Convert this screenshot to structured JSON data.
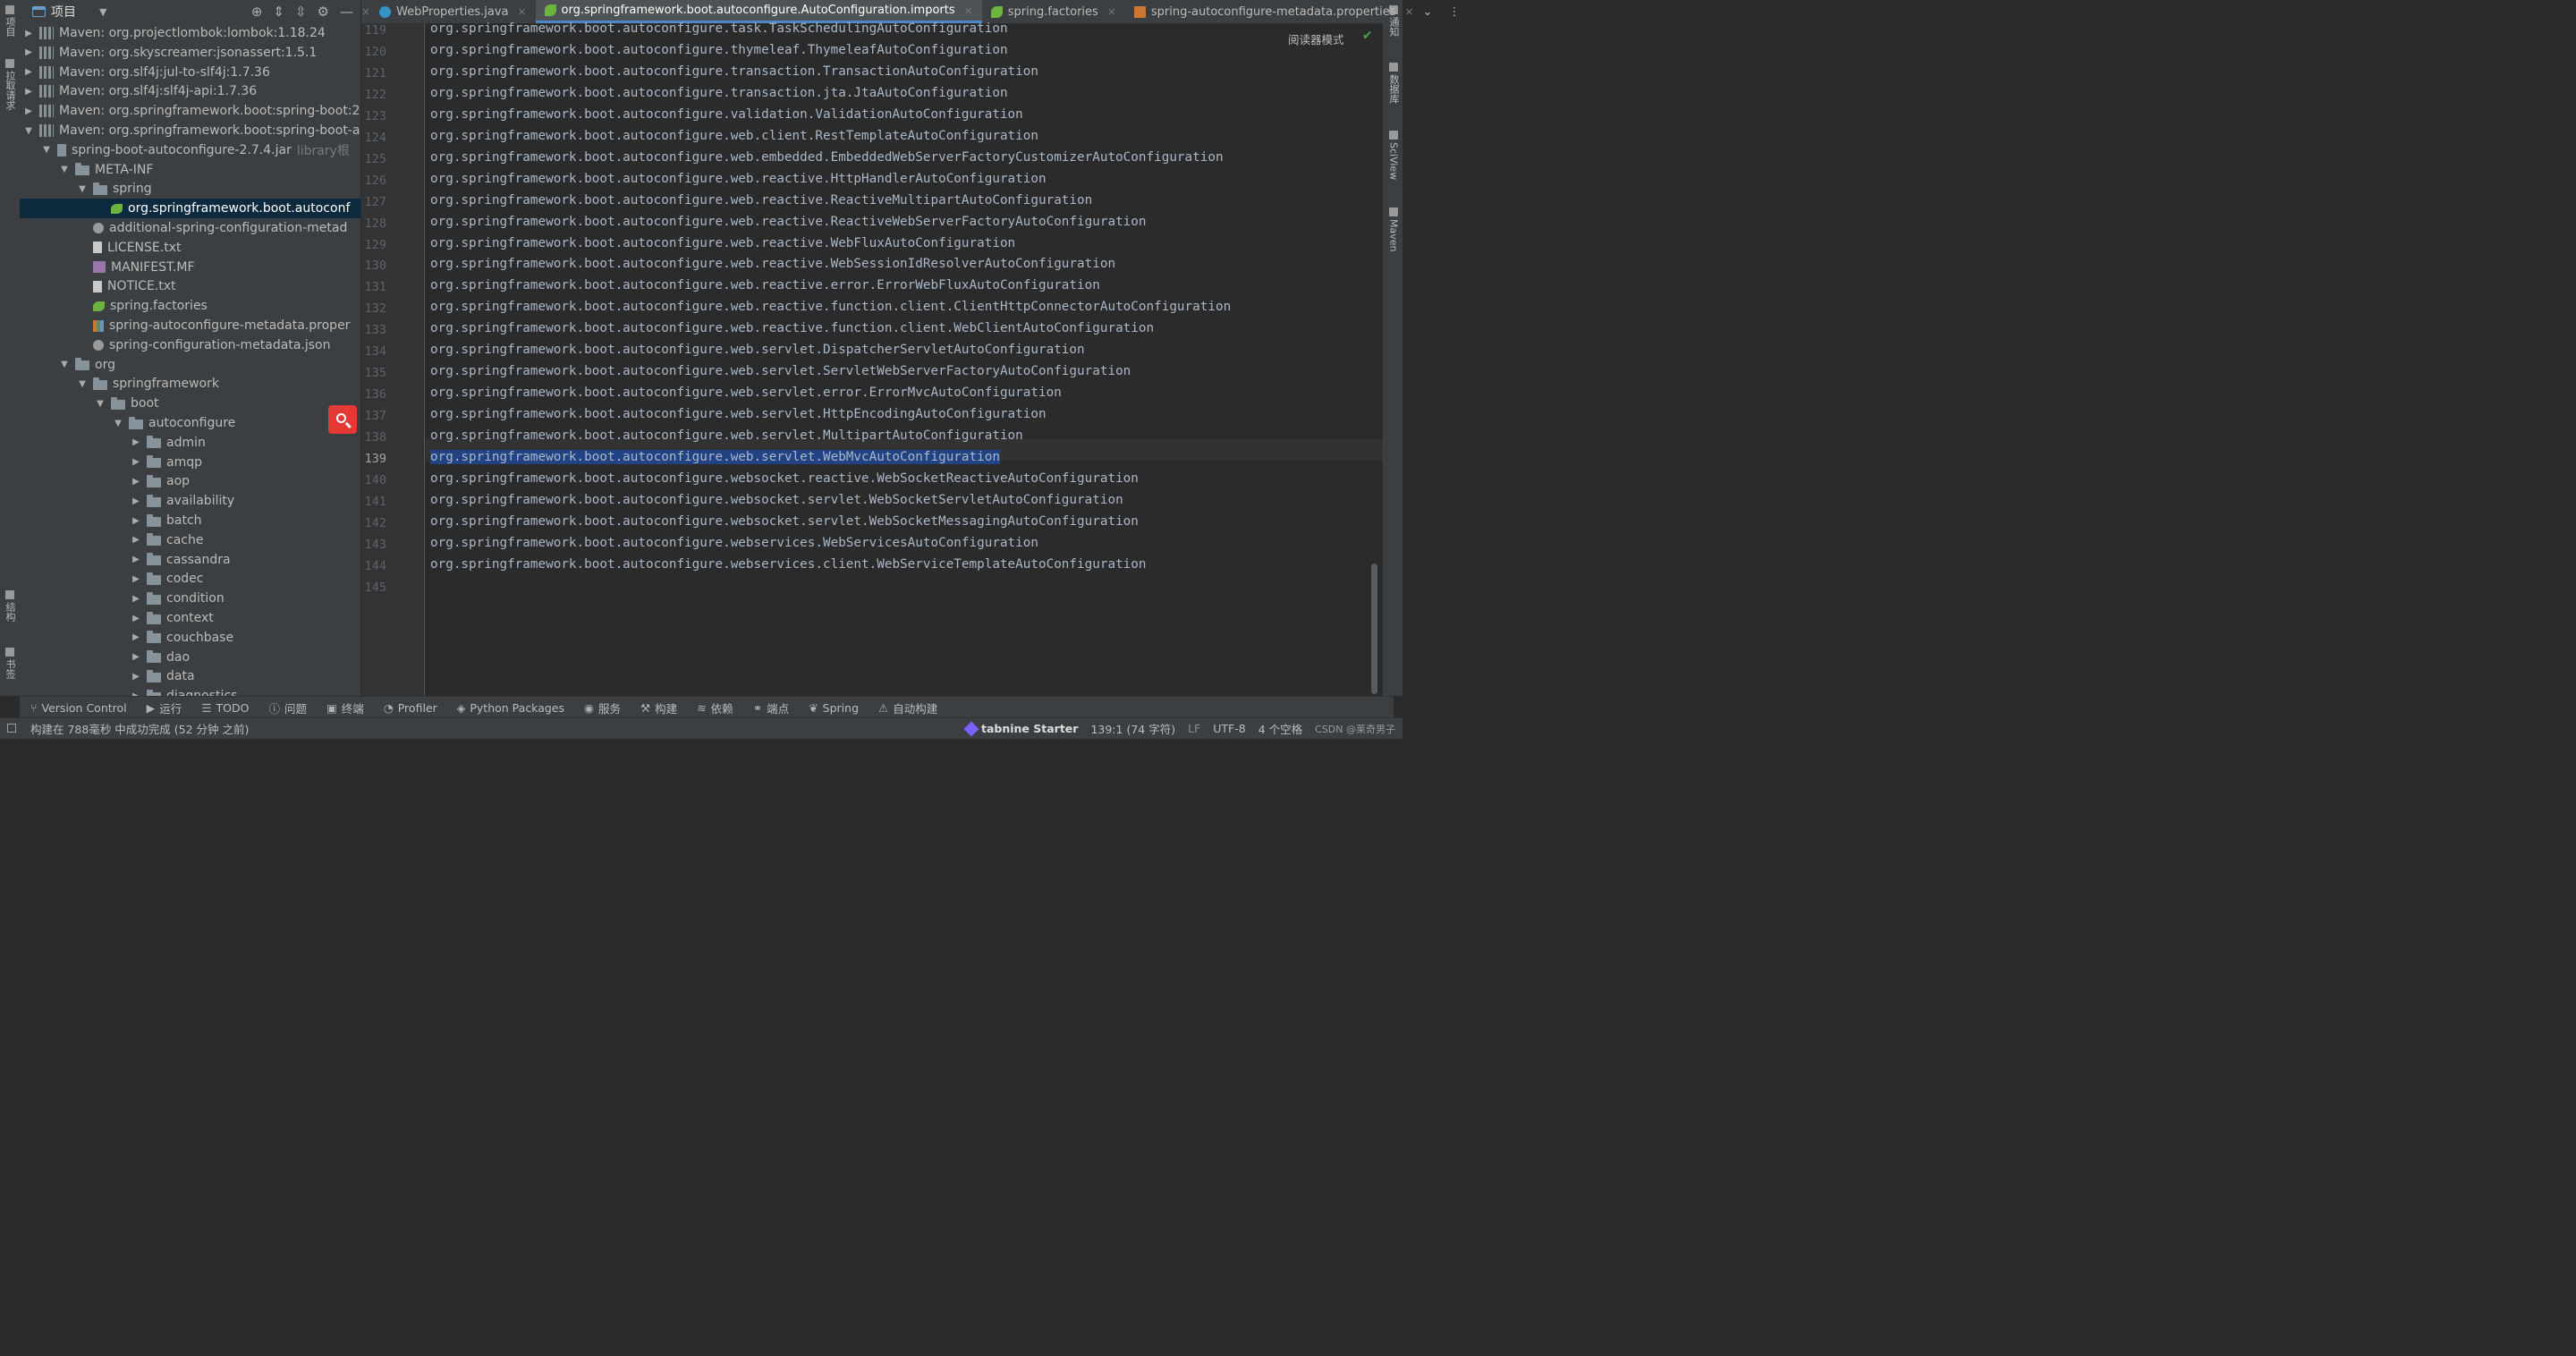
{
  "left_stripe": {
    "top_tabs": [
      "项目",
      "拉取请求"
    ],
    "bottom_tabs": [
      "结构",
      "书签"
    ]
  },
  "right_stripe": {
    "tabs": [
      "通知",
      "数据库",
      "SciView",
      "Maven"
    ]
  },
  "project_panel": {
    "title": "项目",
    "tree": [
      {
        "label": "Maven: org.projectlombok:lombok:1.18.24",
        "icon": "library-icon",
        "expanded": false
      },
      {
        "label": "Maven: org.skyscreamer:jsonassert:1.5.1",
        "icon": "library-icon",
        "expanded": false
      },
      {
        "label": "Maven: org.slf4j:jul-to-slf4j:1.7.36",
        "icon": "library-icon",
        "expanded": false
      },
      {
        "label": "Maven: org.slf4j:slf4j-api:1.7.36",
        "icon": "library-icon",
        "expanded": false
      },
      {
        "label": "Maven: org.springframework.boot:spring-boot:2",
        "icon": "library-icon",
        "expanded": false
      },
      {
        "label": "Maven: org.springframework.boot:spring-boot-a",
        "icon": "library-icon",
        "expanded": true
      },
      {
        "label": "spring-boot-autoconfigure-2.7.4.jar",
        "suffix": "library根",
        "icon": "jar-icon",
        "expanded": true
      },
      {
        "label": "META-INF",
        "icon": "folder-icon",
        "expanded": true
      },
      {
        "label": "spring",
        "icon": "folder-icon",
        "expanded": true
      },
      {
        "label": "org.springframework.boot.autoconf",
        "icon": "spring-icon",
        "selected": true
      },
      {
        "label": "additional-spring-configuration-metad",
        "icon": "json-icon"
      },
      {
        "label": "LICENSE.txt",
        "icon": "text-file-icon"
      },
      {
        "label": "MANIFEST.MF",
        "icon": "manifest-icon"
      },
      {
        "label": "NOTICE.txt",
        "icon": "text-file-icon"
      },
      {
        "label": "spring.factories",
        "icon": "spring-icon"
      },
      {
        "label": "spring-autoconfigure-metadata.proper",
        "icon": "properties-icon"
      },
      {
        "label": "spring-configuration-metadata.json",
        "icon": "json-icon"
      },
      {
        "label": "org",
        "icon": "folder-icon",
        "expanded": true
      },
      {
        "label": "springframework",
        "icon": "folder-icon",
        "expanded": true
      },
      {
        "label": "boot",
        "icon": "folder-icon",
        "expanded": true
      },
      {
        "label": "autoconfigure",
        "icon": "folder-icon",
        "expanded": true
      },
      {
        "label": "admin",
        "icon": "folder-icon",
        "expanded": false
      },
      {
        "label": "amqp",
        "icon": "folder-icon",
        "expanded": false
      },
      {
        "label": "aop",
        "icon": "folder-icon",
        "expanded": false
      },
      {
        "label": "availability",
        "icon": "folder-icon",
        "expanded": false
      },
      {
        "label": "batch",
        "icon": "folder-icon",
        "expanded": false
      },
      {
        "label": "cache",
        "icon": "folder-icon",
        "expanded": false
      },
      {
        "label": "cassandra",
        "icon": "folder-icon",
        "expanded": false
      },
      {
        "label": "codec",
        "icon": "folder-icon",
        "expanded": false
      },
      {
        "label": "condition",
        "icon": "folder-icon",
        "expanded": false
      },
      {
        "label": "context",
        "icon": "folder-icon",
        "expanded": false
      },
      {
        "label": "couchbase",
        "icon": "folder-icon",
        "expanded": false
      },
      {
        "label": "dao",
        "icon": "folder-icon",
        "expanded": false
      },
      {
        "label": "data",
        "icon": "folder-icon",
        "expanded": false
      },
      {
        "label": "diagnostics",
        "icon": "folder-icon",
        "expanded": false
      }
    ]
  },
  "editor": {
    "tabs": [
      {
        "label": "WebProperties.java",
        "icon": "java-class-icon",
        "active": false
      },
      {
        "label": "org.springframework.boot.autoconfigure.AutoConfiguration.imports",
        "icon": "spring-icon",
        "active": true
      },
      {
        "label": "spring.factories",
        "icon": "spring-icon",
        "active": false
      },
      {
        "label": "spring-autoconfigure-metadata.properties",
        "icon": "properties-icon",
        "active": false
      }
    ],
    "reader_mode": "阅读器模式",
    "current_line": "139",
    "lines": [
      {
        "num": "119",
        "text": "org.springframework.boot.autoconfigure.task.TaskSchedulingAutoConfiguration"
      },
      {
        "num": "120",
        "text": "org.springframework.boot.autoconfigure.thymeleaf.ThymeleafAutoConfiguration"
      },
      {
        "num": "121",
        "text": "org.springframework.boot.autoconfigure.transaction.TransactionAutoConfiguration"
      },
      {
        "num": "122",
        "text": "org.springframework.boot.autoconfigure.transaction.jta.JtaAutoConfiguration"
      },
      {
        "num": "123",
        "text": "org.springframework.boot.autoconfigure.validation.ValidationAutoConfiguration"
      },
      {
        "num": "124",
        "text": "org.springframework.boot.autoconfigure.web.client.RestTemplateAutoConfiguration"
      },
      {
        "num": "125",
        "text": "org.springframework.boot.autoconfigure.web.embedded.EmbeddedWebServerFactoryCustomizerAutoConfiguration"
      },
      {
        "num": "126",
        "text": "org.springframework.boot.autoconfigure.web.reactive.HttpHandlerAutoConfiguration"
      },
      {
        "num": "127",
        "text": "org.springframework.boot.autoconfigure.web.reactive.ReactiveMultipartAutoConfiguration"
      },
      {
        "num": "128",
        "text": "org.springframework.boot.autoconfigure.web.reactive.ReactiveWebServerFactoryAutoConfiguration"
      },
      {
        "num": "129",
        "text": "org.springframework.boot.autoconfigure.web.reactive.WebFluxAutoConfiguration"
      },
      {
        "num": "130",
        "text": "org.springframework.boot.autoconfigure.web.reactive.WebSessionIdResolverAutoConfiguration"
      },
      {
        "num": "131",
        "text": "org.springframework.boot.autoconfigure.web.reactive.error.ErrorWebFluxAutoConfiguration"
      },
      {
        "num": "132",
        "text": "org.springframework.boot.autoconfigure.web.reactive.function.client.ClientHttpConnectorAutoConfiguration"
      },
      {
        "num": "133",
        "text": "org.springframework.boot.autoconfigure.web.reactive.function.client.WebClientAutoConfiguration"
      },
      {
        "num": "134",
        "text": "org.springframework.boot.autoconfigure.web.servlet.DispatcherServletAutoConfiguration"
      },
      {
        "num": "135",
        "text": "org.springframework.boot.autoconfigure.web.servlet.ServletWebServerFactoryAutoConfiguration"
      },
      {
        "num": "136",
        "text": "org.springframework.boot.autoconfigure.web.servlet.error.ErrorMvcAutoConfiguration"
      },
      {
        "num": "137",
        "text": "org.springframework.boot.autoconfigure.web.servlet.HttpEncodingAutoConfiguration"
      },
      {
        "num": "138",
        "text": "org.springframework.boot.autoconfigure.web.servlet.MultipartAutoConfiguration"
      },
      {
        "num": "139",
        "text": "org.springframework.boot.autoconfigure.web.servlet.WebMvcAutoConfiguration",
        "selected": true
      },
      {
        "num": "140",
        "text": "org.springframework.boot.autoconfigure.websocket.reactive.WebSocketReactiveAutoConfiguration"
      },
      {
        "num": "141",
        "text": "org.springframework.boot.autoconfigure.websocket.servlet.WebSocketServletAutoConfiguration"
      },
      {
        "num": "142",
        "text": "org.springframework.boot.autoconfigure.websocket.servlet.WebSocketMessagingAutoConfiguration"
      },
      {
        "num": "143",
        "text": "org.springframework.boot.autoconfigure.webservices.WebServicesAutoConfiguration"
      },
      {
        "num": "144",
        "text": "org.springframework.boot.autoconfigure.webservices.client.WebServiceTemplateAutoConfiguration"
      },
      {
        "num": "145",
        "text": ""
      }
    ]
  },
  "tool_windows": [
    {
      "label": "Version Control",
      "icon": "branch-icon"
    },
    {
      "label": "运行",
      "icon": "run-icon"
    },
    {
      "label": "TODO",
      "icon": "list-icon"
    },
    {
      "label": "问题",
      "icon": "info-icon"
    },
    {
      "label": "终端",
      "icon": "terminal-icon"
    },
    {
      "label": "Profiler",
      "icon": "profiler-icon"
    },
    {
      "label": "Python Packages",
      "icon": "layers-icon"
    },
    {
      "label": "服务",
      "icon": "services-icon"
    },
    {
      "label": "构建",
      "icon": "hammer-icon"
    },
    {
      "label": "依赖",
      "icon": "stack-icon"
    },
    {
      "label": "端点",
      "icon": "endpoints-icon"
    },
    {
      "label": "Spring",
      "icon": "spring-icon"
    },
    {
      "label": "自动构建",
      "icon": "warning-icon"
    }
  ],
  "status_bar": {
    "message": "构建在 788毫秒 中成功完成 (52 分钟 之前)",
    "tabnine": "tabnine Starter",
    "position": "139:1 (74 字符)",
    "line_separator": "LF",
    "encoding": "UTF-8",
    "indent": "4 个空格",
    "overlay": "CSDN @莱奇男子"
  }
}
